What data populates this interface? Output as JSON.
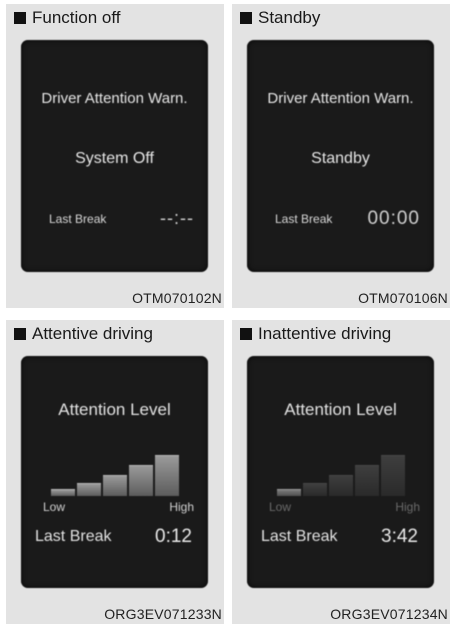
{
  "panels": [
    {
      "caption": "Function off",
      "title": "Driver Attention Warn.",
      "status": "System Off",
      "last_break_label": "Last Break",
      "time": "--:--",
      "code": "OTM070102N"
    },
    {
      "caption": "Standby",
      "title": "Driver Attention Warn.",
      "status": "Standby",
      "last_break_label": "Last Break",
      "time": "00:00",
      "code": "OTM070106N"
    },
    {
      "caption": "Attentive driving",
      "title": "Attention Level",
      "low_label": "Low",
      "high_label": "High",
      "last_break_label": "Last Break",
      "time": "0:12",
      "code": "ORG3EV071233N",
      "level": 5
    },
    {
      "caption": "Inattentive driving",
      "title": "Attention Level",
      "low_label": "Low",
      "high_label": "High",
      "last_break_label": "Last Break",
      "time": "3:42",
      "code": "ORG3EV071234N",
      "level": 1
    }
  ],
  "colors": {
    "screen": "#1a1a1a",
    "panel": "#e3e3e3"
  }
}
